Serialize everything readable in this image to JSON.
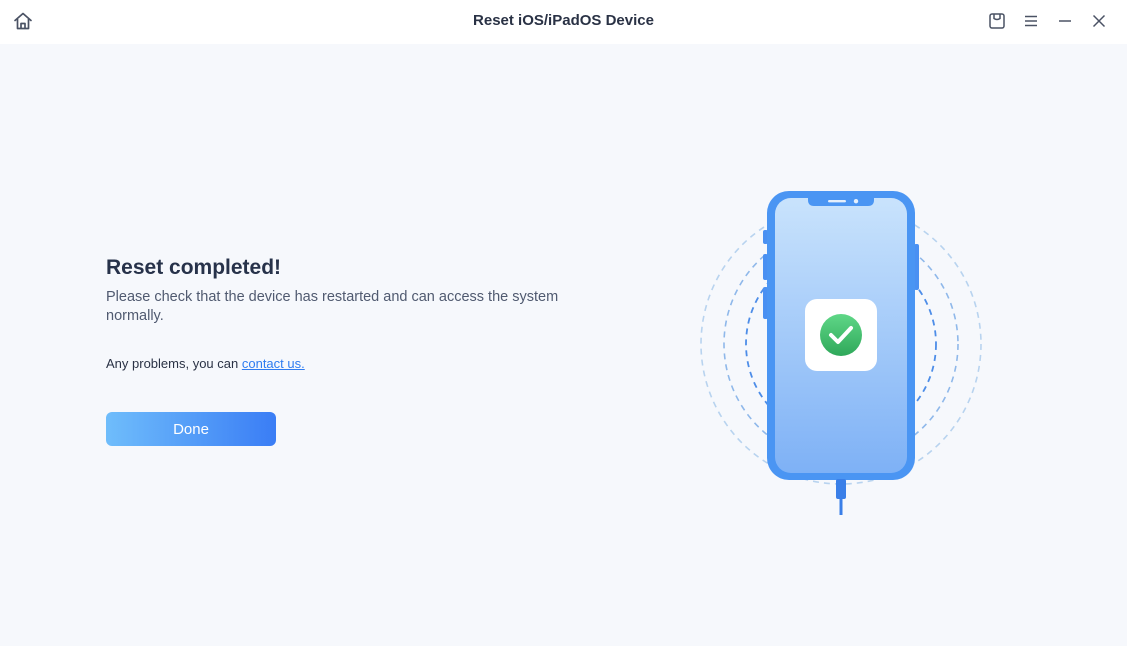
{
  "window": {
    "title": "Reset iOS/iPadOS Device"
  },
  "titlebar": {
    "icons": {
      "home": "home-icon",
      "feedback": "feedback-icon",
      "menu": "menu-icon",
      "minimize": "minimize-icon",
      "close": "close-icon"
    }
  },
  "main": {
    "heading": "Reset completed!",
    "description": "Please check that the device has restarted and can access the system normally.",
    "problems_prefix": "Any problems, you can ",
    "contact_link": "contact us.",
    "done_button": "Done"
  },
  "illustration": {
    "device": "phone-illustration",
    "status_icon": "check-icon"
  },
  "colors": {
    "accent": "#3a7df5",
    "link": "#2f7cf0",
    "success": "#3ec06a",
    "heading": "#27324a",
    "background": "#f6f8fc"
  }
}
